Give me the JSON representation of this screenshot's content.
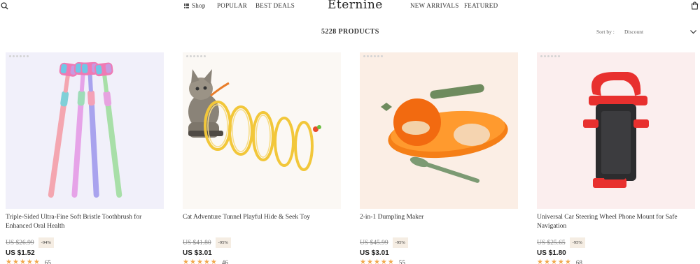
{
  "header": {
    "search_icon": "search-icon",
    "nav_left": [
      "Shop",
      "POPULAR",
      "BEST DEALS"
    ],
    "logo": "Eternine",
    "nav_right": [
      "NEW ARRIVALS",
      "FEATURED"
    ],
    "bag_icon": "shopping-bag-icon"
  },
  "toolbar": {
    "count": "5228 PRODUCTS",
    "sort_label": "Sort by :",
    "sort_value": "Discount"
  },
  "colors": {
    "star": "#f1a84e",
    "badge_bg": "#f5ede3"
  },
  "products": [
    {
      "title": "Triple-Sided Ultra-Fine Soft Bristle Toothbrush for Enhanced Oral Health",
      "old_price": "US $26.99",
      "discount": "-94%",
      "price": "US $1.52",
      "stars": 5,
      "reviews": "65",
      "image_icon": "toothbrush-image"
    },
    {
      "title": "Cat Adventure Tunnel Playful Hide & Seek Toy",
      "old_price": "US $41.80",
      "discount": "-95%",
      "price": "US $3.01",
      "stars": 5,
      "reviews": "46",
      "image_icon": "cat-tunnel-image"
    },
    {
      "title": "2-in-1 Dumpling Maker",
      "old_price": "US $45.99",
      "discount": "-95%",
      "price": "US $3.01",
      "stars": 5,
      "reviews": "55",
      "image_icon": "dumpling-maker-image"
    },
    {
      "title": "Universal Car Steering Wheel Phone Mount for Safe Navigation",
      "old_price": "US $25.65",
      "discount": "-95%",
      "price": "US $1.80",
      "stars": 5,
      "reviews": "68",
      "image_icon": "phone-mount-image"
    }
  ]
}
